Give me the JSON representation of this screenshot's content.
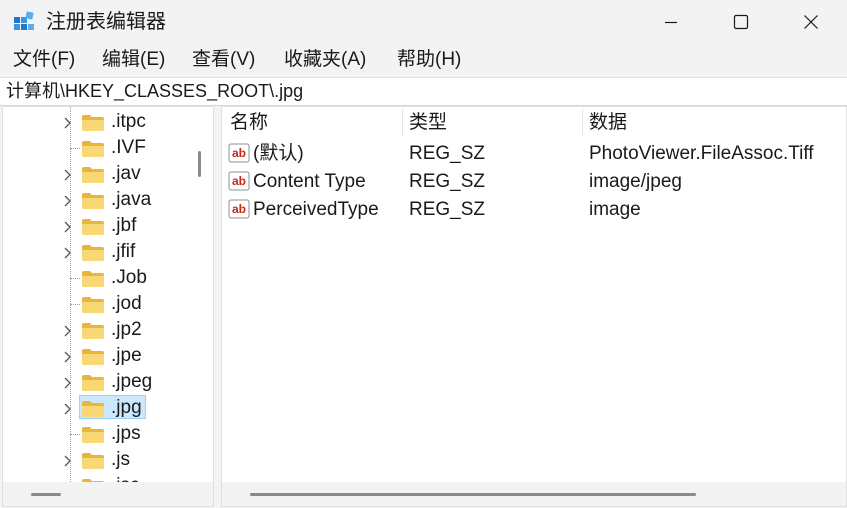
{
  "window": {
    "title": "注册表编辑器",
    "app_icon": "registry-editor-icon"
  },
  "menu": {
    "items": [
      {
        "label": "文件(F)"
      },
      {
        "label": "编辑(E)"
      },
      {
        "label": "查看(V)"
      },
      {
        "label": "收藏夹(A)"
      },
      {
        "label": "帮助(H)"
      }
    ]
  },
  "address": {
    "path": "计算机\\HKEY_CLASSES_ROOT\\.jpg"
  },
  "tree": {
    "items": [
      {
        "label": ".itpc",
        "expandable": true,
        "selected": false
      },
      {
        "label": ".IVF",
        "expandable": false,
        "selected": false
      },
      {
        "label": ".jav",
        "expandable": true,
        "selected": false
      },
      {
        "label": ".java",
        "expandable": true,
        "selected": false
      },
      {
        "label": ".jbf",
        "expandable": true,
        "selected": false
      },
      {
        "label": ".jfif",
        "expandable": true,
        "selected": false
      },
      {
        "label": ".Job",
        "expandable": false,
        "selected": false
      },
      {
        "label": ".jod",
        "expandable": false,
        "selected": false
      },
      {
        "label": ".jp2",
        "expandable": true,
        "selected": false
      },
      {
        "label": ".jpe",
        "expandable": true,
        "selected": false
      },
      {
        "label": ".jpeg",
        "expandable": true,
        "selected": false
      },
      {
        "label": ".jpg",
        "expandable": true,
        "selected": true
      },
      {
        "label": ".jps",
        "expandable": false,
        "selected": false
      },
      {
        "label": ".js",
        "expandable": true,
        "selected": false
      },
      {
        "label": ".jsc",
        "expandable": false,
        "selected": false
      }
    ]
  },
  "list": {
    "columns": {
      "name": "名称",
      "type": "类型",
      "data": "数据"
    },
    "rows": [
      {
        "name": "(默认)",
        "type": "REG_SZ",
        "data": "PhotoViewer.FileAssoc.Tiff",
        "icon": "string-value-icon"
      },
      {
        "name": "Content Type",
        "type": "REG_SZ",
        "data": "image/jpeg",
        "icon": "string-value-icon"
      },
      {
        "name": "PerceivedType",
        "type": "REG_SZ",
        "data": "image",
        "icon": "string-value-icon"
      }
    ]
  },
  "colors": {
    "selection_fill": "#cce8ff",
    "selection_border": "#99d1ff",
    "folder_yellow": "#f8d775",
    "string_icon_red": "#c42b1c"
  }
}
